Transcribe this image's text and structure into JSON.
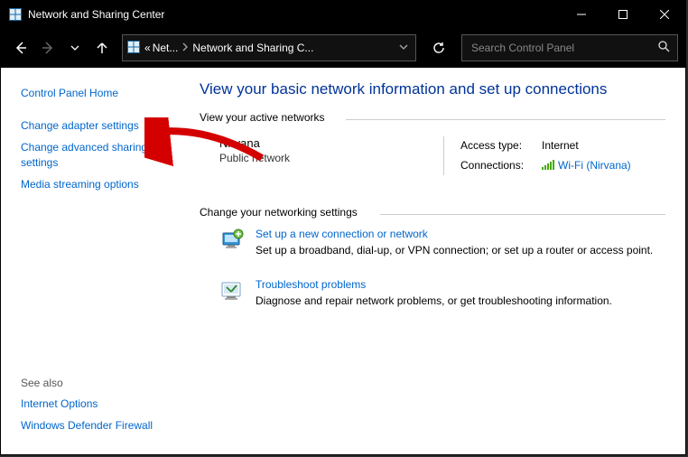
{
  "titlebar": {
    "title": "Network and Sharing Center"
  },
  "navbar": {
    "breadcrumb": {
      "prefix": "«",
      "seg1": "Net...",
      "seg2": "Network and Sharing C..."
    },
    "search_placeholder": "Search Control Panel"
  },
  "sidebar": {
    "cph": "Control Panel Home",
    "links": [
      "Change adapter settings",
      "Change advanced sharing settings",
      "Media streaming options"
    ],
    "see_also_label": "See also",
    "see_also": [
      "Internet Options",
      "Windows Defender Firewall"
    ]
  },
  "main": {
    "heading": "View your basic network information and set up connections",
    "active_label": "View your active networks",
    "network": {
      "name": "Nirvana",
      "type": "Public network",
      "access_label": "Access type:",
      "access_value": "Internet",
      "conn_label": "Connections:",
      "conn_link": "Wi-Fi (Nirvana)"
    },
    "change_label": "Change your networking settings",
    "items": [
      {
        "title": "Set up a new connection or network",
        "desc": "Set up a broadband, dial-up, or VPN connection; or set up a router or access point."
      },
      {
        "title": "Troubleshoot problems",
        "desc": "Diagnose and repair network problems, or get troubleshooting information."
      }
    ]
  }
}
